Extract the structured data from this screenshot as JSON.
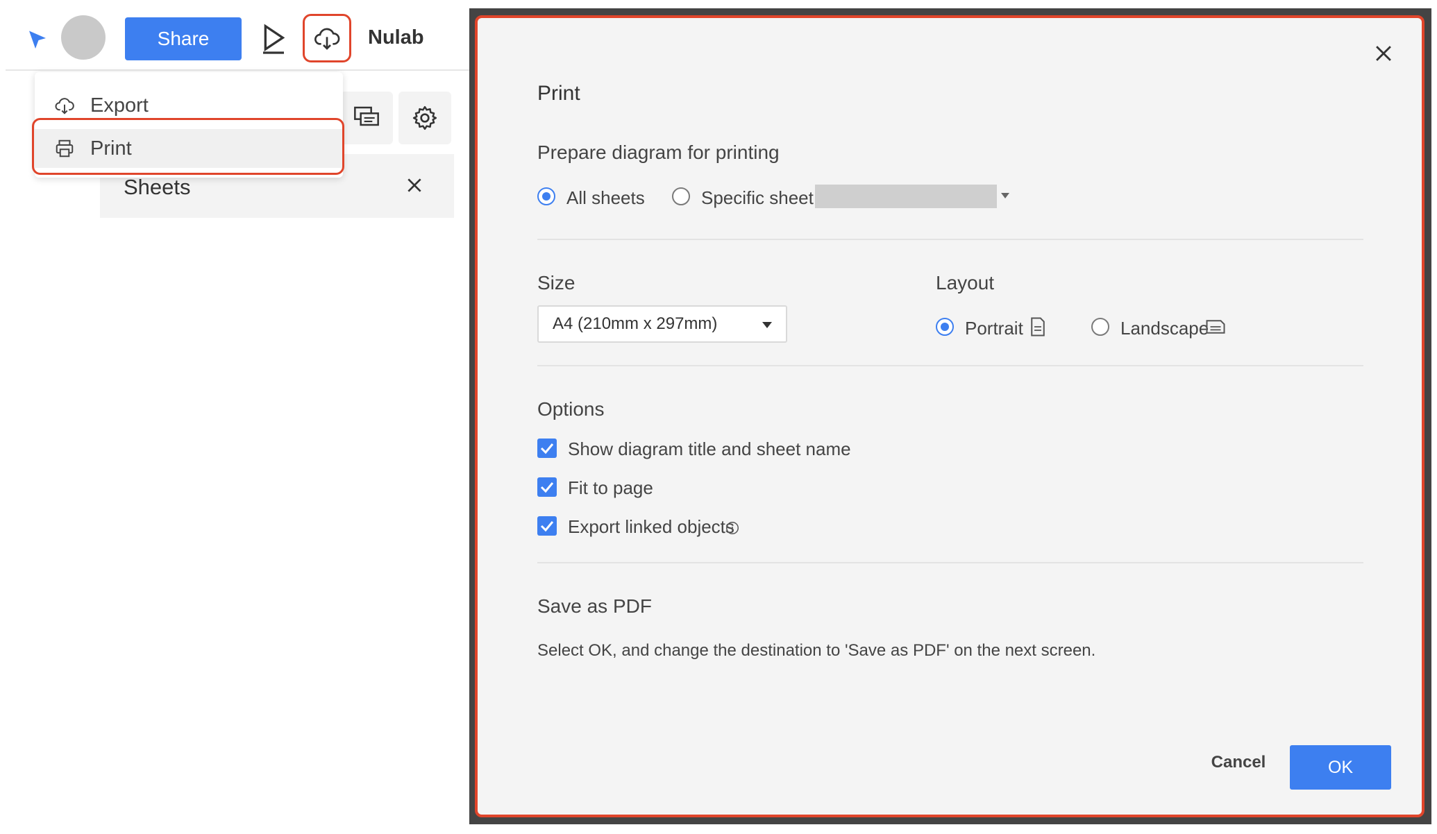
{
  "toolbar": {
    "share_label": "Share",
    "brand": "Nulab"
  },
  "menu": {
    "items": [
      {
        "label": "Export",
        "icon": "cloud-upload-icon"
      },
      {
        "label": "Print",
        "icon": "printer-icon"
      }
    ]
  },
  "sheets_panel": {
    "title": "Sheets"
  },
  "dialog": {
    "title": "Print",
    "prepare": {
      "label": "Prepare diagram for printing",
      "options": [
        "All sheets",
        "Specific sheet"
      ],
      "selected": "All sheets"
    },
    "size": {
      "label": "Size",
      "value": "A4 (210mm x 297mm)"
    },
    "layout": {
      "label": "Layout",
      "options": [
        "Portrait",
        "Landscape"
      ],
      "selected": "Portrait"
    },
    "options": {
      "label": "Options",
      "items": [
        {
          "label": "Show diagram title and sheet name",
          "checked": true
        },
        {
          "label": "Fit to page",
          "checked": true
        },
        {
          "label": "Export linked objects",
          "checked": true
        }
      ]
    },
    "pdf": {
      "label": "Save as PDF",
      "text": "Select OK, and change the destination to 'Save as PDF' on the next screen."
    },
    "cancel_label": "Cancel",
    "ok_label": "OK"
  },
  "colors": {
    "accent": "#3d7ff0",
    "highlight": "#e0452b"
  }
}
